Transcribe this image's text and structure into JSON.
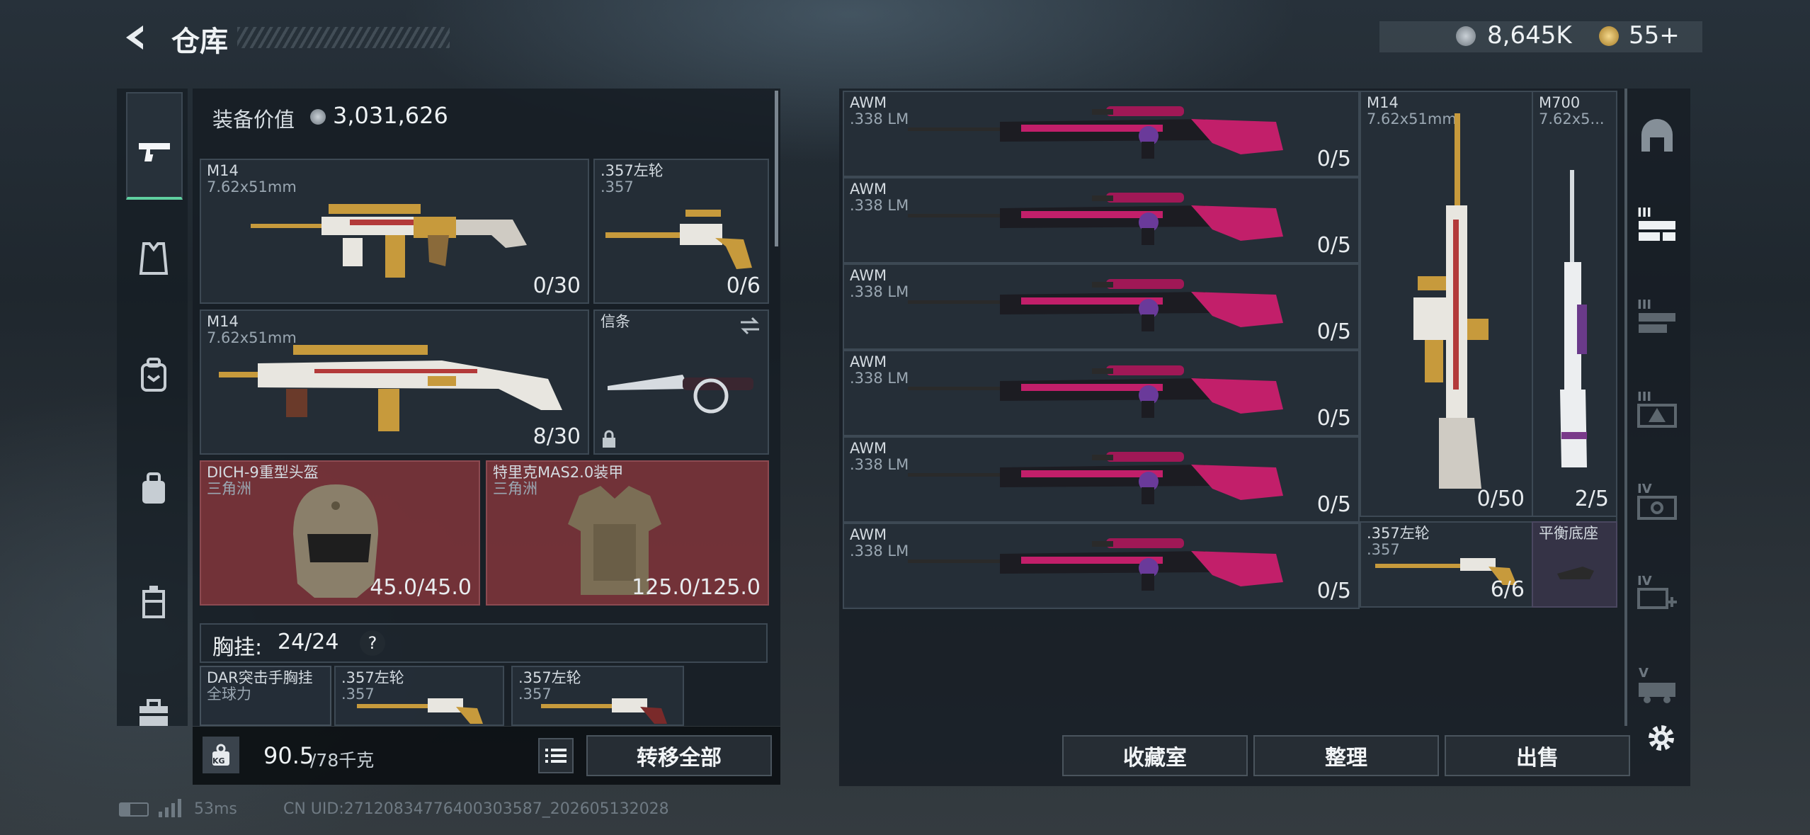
{
  "header": {
    "title": "仓库",
    "currency1": "8,645K",
    "currency2": "55+"
  },
  "loadout": {
    "value_label": "装备价值",
    "value": "3,031,626",
    "items": [
      {
        "name": "M14",
        "sub": "7.62x51mm",
        "count": "0/30"
      },
      {
        "name": ".357左轮",
        "sub": ".357",
        "count": "0/6"
      },
      {
        "name": "M14",
        "sub": "7.62x51mm",
        "count": "8/30"
      },
      {
        "name": "信条",
        "sub": "",
        "count": ""
      },
      {
        "name": "DICH-9重型头盔",
        "sub": "三角洲",
        "count": "45.0/45.0"
      },
      {
        "name": "特里克MAS2.0装甲",
        "sub": "三角洲",
        "count": "125.0/125.0"
      }
    ],
    "rig_label": "胸挂:",
    "rig_count": "24/24",
    "rig_help": "?",
    "rig_items": [
      {
        "name": "DAR突击手胸挂",
        "sub": "全球力"
      },
      {
        "name": ".357左轮",
        "sub": ".357"
      },
      {
        "name": ".357左轮",
        "sub": ".357"
      }
    ],
    "weight": "90.5",
    "weight_max": "/78千克",
    "kg": "KG",
    "transfer_all": "转移全部"
  },
  "storage": {
    "items": [
      {
        "name": "AWM",
        "sub": ".338 LM",
        "count": "0/5"
      },
      {
        "name": "AWM",
        "sub": ".338 LM",
        "count": "0/5"
      },
      {
        "name": "AWM",
        "sub": ".338 LM",
        "count": "0/5"
      },
      {
        "name": "AWM",
        "sub": ".338 LM",
        "count": "0/5"
      },
      {
        "name": "AWM",
        "sub": ".338 LM",
        "count": "0/5"
      },
      {
        "name": "AWM",
        "sub": ".338 LM",
        "count": "0/5"
      },
      {
        "name": "M14",
        "sub": "7.62x51mm",
        "count": "0/50"
      },
      {
        "name": "M700",
        "sub": "7.62x5...",
        "count": "2/5"
      },
      {
        "name": ".357左轮",
        "sub": ".357",
        "count": "6/6"
      },
      {
        "name": "平衡底座",
        "sub": "",
        "count": ""
      }
    ],
    "btn_collection": "收藏室",
    "btn_sort": "整理",
    "btn_sell": "出售"
  },
  "tabs": {
    "t1": "III",
    "t2": "III",
    "t3": "III",
    "t4": "IV",
    "t5": "IV",
    "t6": "V"
  },
  "status": {
    "ping": "53ms",
    "uid": "CN UID:27120834776400303587_202605132028"
  },
  "colors": {
    "accent": "#5fcfa0",
    "red_slot": "#7a343a",
    "gold": "#c79a3c"
  }
}
